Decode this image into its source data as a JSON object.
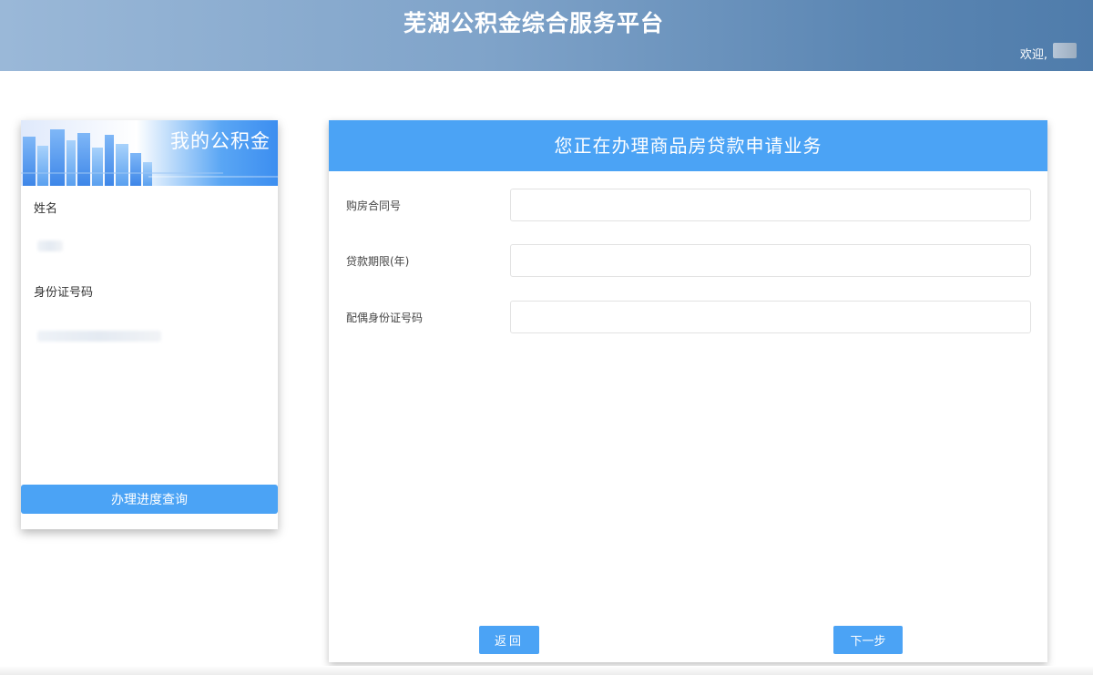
{
  "header": {
    "title": "芜湖公积金综合服务平台",
    "welcome": "欢迎,"
  },
  "left_card": {
    "banner_title": "我的公积金",
    "name_label": "姓名",
    "id_label": "身份证号码",
    "progress_button": "办理进度查询"
  },
  "main": {
    "panel_title": "您正在办理商品房贷款申请业务",
    "fields": [
      {
        "label": "购房合同号",
        "value": "",
        "placeholder": ""
      },
      {
        "label": "贷款期限(年)",
        "value": "",
        "placeholder": ""
      },
      {
        "label": "配偶身份证号码",
        "value": "",
        "placeholder": ""
      }
    ],
    "back_button": "返回",
    "next_button": "下一步"
  },
  "colors": {
    "accent": "#4ba3f5",
    "header_start": "#9ab8d8",
    "header_end": "#4f7cab"
  }
}
